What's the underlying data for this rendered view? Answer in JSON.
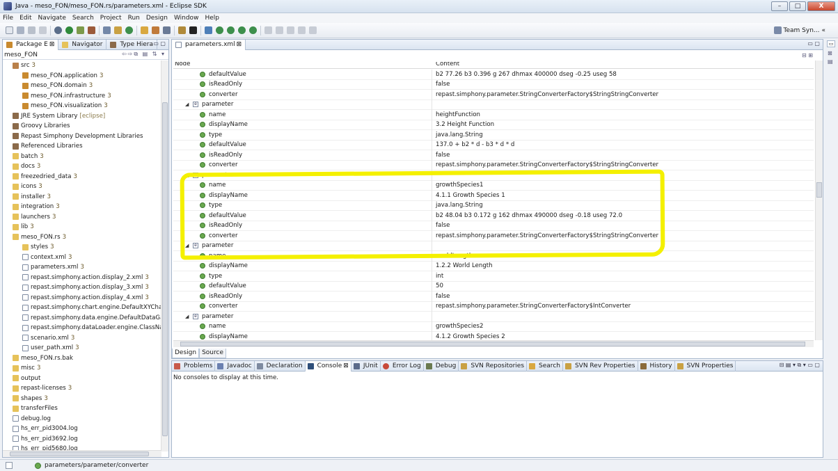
{
  "window": {
    "title": "Java - meso_FON/meso_FON.rs/parameters.xml - Eclipse SDK",
    "minimize": "–",
    "maximize": "□",
    "close": "X"
  },
  "menu": [
    "File",
    "Edit",
    "Navigate",
    "Search",
    "Project",
    "Run",
    "Design",
    "Window",
    "Help"
  ],
  "toolbar": {
    "team_sync": "Team Syn...",
    "overflow": "«"
  },
  "left_tabs": [
    {
      "label": "Package E",
      "close": "⊠"
    },
    {
      "label": "Navigator",
      "close": ""
    },
    {
      "label": "Type Hiera",
      "close": ""
    }
  ],
  "left_header": "meso_FON",
  "tree": [
    {
      "indent": 1,
      "icon": "src",
      "label": "src",
      "count": "3"
    },
    {
      "indent": 2,
      "icon": "pkg",
      "label": "meso_FON.application",
      "count": "3"
    },
    {
      "indent": 2,
      "icon": "pkg",
      "label": "meso_FON.domain",
      "count": "3"
    },
    {
      "indent": 2,
      "icon": "pkg",
      "label": "meso_FON.infrastructure",
      "count": "3"
    },
    {
      "indent": 2,
      "icon": "pkg",
      "label": "meso_FON.visualization",
      "count": "3"
    },
    {
      "indent": 1,
      "icon": "lib",
      "label": "JRE System Library",
      "count": "[eclipse]"
    },
    {
      "indent": 1,
      "icon": "lib",
      "label": "Groovy Libraries",
      "count": ""
    },
    {
      "indent": 1,
      "icon": "lib",
      "label": "Repast Simphony Development Libraries",
      "count": ""
    },
    {
      "indent": 1,
      "icon": "lib",
      "label": "Referenced Libraries",
      "count": ""
    },
    {
      "indent": 1,
      "icon": "fold",
      "label": "batch",
      "count": "3"
    },
    {
      "indent": 1,
      "icon": "fold",
      "label": "docs",
      "count": "3"
    },
    {
      "indent": 1,
      "icon": "fold",
      "label": "freezedried_data",
      "count": "3"
    },
    {
      "indent": 1,
      "icon": "fold",
      "label": "icons",
      "count": "3"
    },
    {
      "indent": 1,
      "icon": "fold",
      "label": "installer",
      "count": "3"
    },
    {
      "indent": 1,
      "icon": "fold",
      "label": "integration",
      "count": "3"
    },
    {
      "indent": 1,
      "icon": "fold",
      "label": "launchers",
      "count": "3"
    },
    {
      "indent": 1,
      "icon": "fold",
      "label": "lib",
      "count": "3"
    },
    {
      "indent": 1,
      "icon": "fold",
      "label": "meso_FON.rs",
      "count": "3"
    },
    {
      "indent": 2,
      "icon": "fold",
      "label": "styles",
      "count": "3"
    },
    {
      "indent": 2,
      "icon": "file",
      "label": "context.xml",
      "count": "3"
    },
    {
      "indent": 2,
      "icon": "file",
      "label": "parameters.xml",
      "count": "3"
    },
    {
      "indent": 2,
      "icon": "file",
      "label": "repast.simphony.action.display_2.xml",
      "count": "3"
    },
    {
      "indent": 2,
      "icon": "file",
      "label": "repast.simphony.action.display_3.xml",
      "count": "3"
    },
    {
      "indent": 2,
      "icon": "file",
      "label": "repast.simphony.action.display_4.xml",
      "count": "3"
    },
    {
      "indent": 2,
      "icon": "file",
      "label": "repast.simphony.chart.engine.DefaultXYChart",
      "count": ""
    },
    {
      "indent": 2,
      "icon": "file",
      "label": "repast.simphony.data.engine.DefaultDataGat",
      "count": ""
    },
    {
      "indent": 2,
      "icon": "file",
      "label": "repast.simphony.dataLoader.engine.ClassNar",
      "count": ""
    },
    {
      "indent": 2,
      "icon": "file",
      "label": "scenario.xml",
      "count": "3"
    },
    {
      "indent": 2,
      "icon": "file",
      "label": "user_path.xml",
      "count": "3"
    },
    {
      "indent": 1,
      "icon": "fold",
      "label": "meso_FON.rs.bak",
      "count": ""
    },
    {
      "indent": 1,
      "icon": "fold",
      "label": "misc",
      "count": "3"
    },
    {
      "indent": 1,
      "icon": "fold",
      "label": "output",
      "count": ""
    },
    {
      "indent": 1,
      "icon": "fold",
      "label": "repast-licenses",
      "count": "3"
    },
    {
      "indent": 1,
      "icon": "fold",
      "label": "shapes",
      "count": "3"
    },
    {
      "indent": 1,
      "icon": "fold",
      "label": "transferFiles",
      "count": ""
    },
    {
      "indent": 1,
      "icon": "file",
      "label": "debug.log",
      "count": ""
    },
    {
      "indent": 1,
      "icon": "file",
      "label": "hs_err_pid3004.log",
      "count": ""
    },
    {
      "indent": 1,
      "icon": "file",
      "label": "hs_err_pid3692.log",
      "count": ""
    },
    {
      "indent": 1,
      "icon": "file",
      "label": "hs_err_pid5680.log",
      "count": ""
    }
  ],
  "editor_tab": {
    "label": "parameters.xml",
    "close": "⊠"
  },
  "grid_headers": {
    "node": "Node",
    "content": "Content"
  },
  "grid_rows": [
    {
      "kind": "attr",
      "node": "defaultValue",
      "value": "b2 77.26 b3 0.396 g 267 dhmax 400000 dseg -0.25 useg 58"
    },
    {
      "kind": "attr",
      "node": "isReadOnly",
      "value": "false"
    },
    {
      "kind": "attr",
      "node": "converter",
      "value": "repast.simphony.parameter.StringConverterFactory$StringStringConverter"
    },
    {
      "kind": "elem",
      "node": "parameter",
      "value": ""
    },
    {
      "kind": "attr",
      "node": "name",
      "value": "heightFunction"
    },
    {
      "kind": "attr",
      "node": "displayName",
      "value": "3.2 Height Function"
    },
    {
      "kind": "attr",
      "node": "type",
      "value": "java.lang.String"
    },
    {
      "kind": "attr",
      "node": "defaultValue",
      "value": "137.0 + b2 * d - b3 * d * d"
    },
    {
      "kind": "attr",
      "node": "isReadOnly",
      "value": "false"
    },
    {
      "kind": "attr",
      "node": "converter",
      "value": "repast.simphony.parameter.StringConverterFactory$StringStringConverter"
    },
    {
      "kind": "elem",
      "node": "parameter",
      "value": ""
    },
    {
      "kind": "attr",
      "node": "name",
      "value": "growthSpecies1"
    },
    {
      "kind": "attr",
      "node": "displayName",
      "value": "4.1.1 Growth Species 1"
    },
    {
      "kind": "attr",
      "node": "type",
      "value": "java.lang.String"
    },
    {
      "kind": "attr",
      "node": "defaultValue",
      "value": "b2 48.04 b3 0.172 g 162 dhmax 490000 dseg -0.18 useg 72.0"
    },
    {
      "kind": "attr",
      "node": "isReadOnly",
      "value": "false"
    },
    {
      "kind": "attr",
      "node": "converter",
      "value": "repast.simphony.parameter.StringConverterFactory$StringStringConverter"
    },
    {
      "kind": "elem",
      "node": "parameter",
      "value": ""
    },
    {
      "kind": "attr",
      "node": "name",
      "value": "worldLength"
    },
    {
      "kind": "attr",
      "node": "displayName",
      "value": "1.2.2 World Length"
    },
    {
      "kind": "attr",
      "node": "type",
      "value": "int"
    },
    {
      "kind": "attr",
      "node": "defaultValue",
      "value": "50"
    },
    {
      "kind": "attr",
      "node": "isReadOnly",
      "value": "false"
    },
    {
      "kind": "attr",
      "node": "converter",
      "value": "repast.simphony.parameter.StringConverterFactory$IntConverter"
    },
    {
      "kind": "elem",
      "node": "parameter",
      "value": ""
    },
    {
      "kind": "attr",
      "node": "name",
      "value": "growthSpecies2"
    },
    {
      "kind": "attr",
      "node": "displayName",
      "value": "4.1.2 Growth Species 2"
    }
  ],
  "editor_bottom_tabs": [
    "Design",
    "Source"
  ],
  "console_tabs": [
    "Problems",
    "Javadoc",
    "Declaration",
    "Console",
    "JUnit",
    "Error Log",
    "Debug",
    "SVN Repositories",
    "Search",
    "SVN Rev Properties",
    "History",
    "SVN Properties"
  ],
  "console_message": "No consoles to display at this time.",
  "status_text": "parameters/parameter/converter",
  "colors": {
    "highlight": "#f4f000",
    "attr_icon": "#6aa84f"
  }
}
